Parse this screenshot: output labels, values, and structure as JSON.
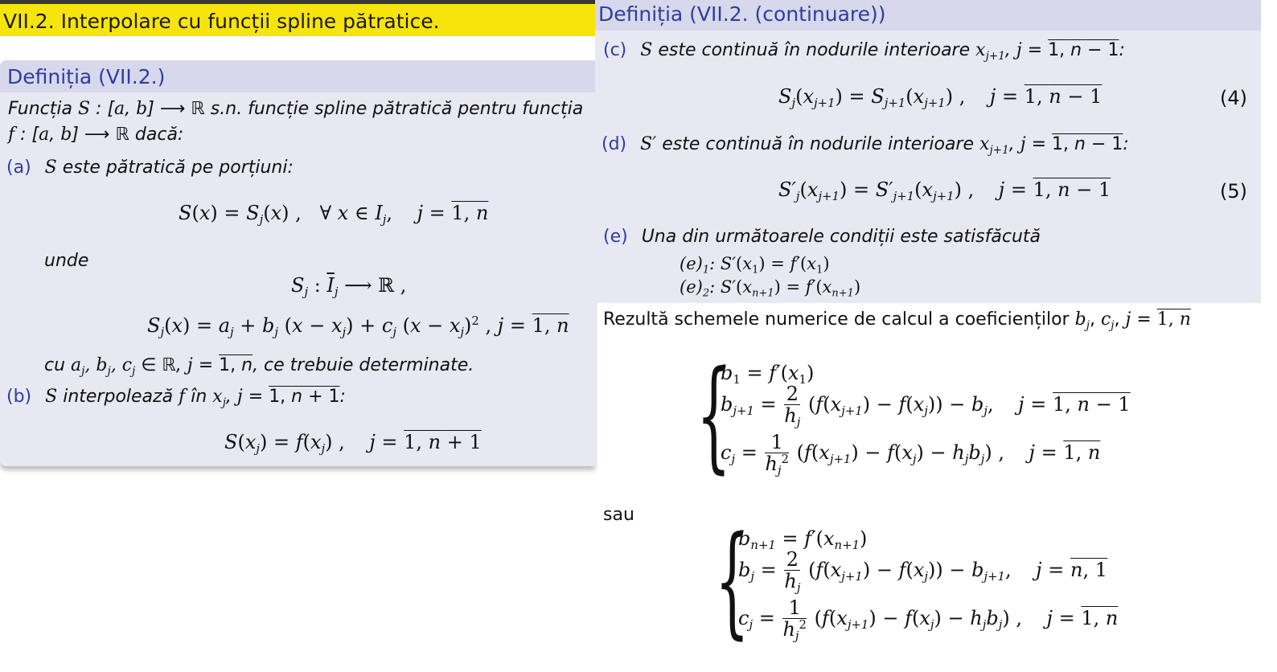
{
  "left": {
    "title": "VII.2. Interpolare cu funcții spline pătratice.",
    "block_title": "Definiția (VII.2.)",
    "intro_line1": "Funcția S : [a, b] ⟶ ℝ s.n. funcție spline pătratică pentru funcția",
    "intro_line2": "f : [a, b] ⟶ ℝ dacă:",
    "a_label": "(a)",
    "a_text": "S este pătratică pe porțiuni:",
    "a_eq": "S(x) = Sj(x) ,   ∀ x ∈ Ij ,    j = 1, n",
    "unde": "unde",
    "sj_def": "Sj : Īj ⟶ ℝ ,",
    "sj_formula": "Sj(x) = aj + bj (x − xj) + cj (x − xj)2 , j = 1, n",
    "cu_line": "cu aj, bj, cj ∈ ℝ, j = 1, n, ce trebuie determinate.",
    "b_label": "(b)",
    "b_text": "S interpolează f în xj, j = 1, n + 1:",
    "b_eq": "S(xj) = f(xj) ,    j = 1, n + 1"
  },
  "right_top": {
    "block_title": "Definiția (VII.2. (continuare))",
    "c_label": "(c)",
    "c_text": "S este continuă în nodurile interioare xj+1, j = 1, n − 1:",
    "eq4": "Sj(xj+1) = Sj+1(xj+1) ,    j = 1, n − 1",
    "eq4_num": "(4)",
    "d_label": "(d)",
    "d_text": "S′ este continuă în nodurile interioare xj+1, j = 1, n − 1:",
    "eq5": "S′j(xj+1) = S′j+1(xj+1) ,    j = 1, n − 1",
    "eq5_num": "(5)",
    "e_label": "(e)",
    "e_text": "Una din următoarele condiții este satisfăcută",
    "e1": "(e)1: S′(x1) = f′(x1)",
    "e2": "(e)2: S′(xn+1) = f′(xn+1)"
  },
  "right_bottom": {
    "intro": "Rezultă schemele numerice de calcul a coeficienților bj, cj, j = 1, n",
    "sys1": {
      "l1": "b1 = f′(x1)",
      "l2": "bj+1 = 2/hj (f(xj+1) − f(xj)) − bj,   j = 1, n − 1",
      "l3": "cj = 1/hj2 (f(xj+1) − f(xj) − hjbj),   j = 1, n"
    },
    "sau": "sau",
    "sys2": {
      "l1": "bn+1 = f′(xn+1)",
      "l2": "bj = 2/hj (f(xj+1) − f(xj)) − bj+1,   j = n, 1",
      "l3": "cj = 1/hj2 (f(xj+1) − f(xj) − hjbj),   j = 1, n"
    }
  },
  "colors": {
    "title_bar": "#f7e40b",
    "block_body": "#e8e8f3",
    "block_head": "#d7d8ec",
    "accent": "#2c3f9e"
  }
}
